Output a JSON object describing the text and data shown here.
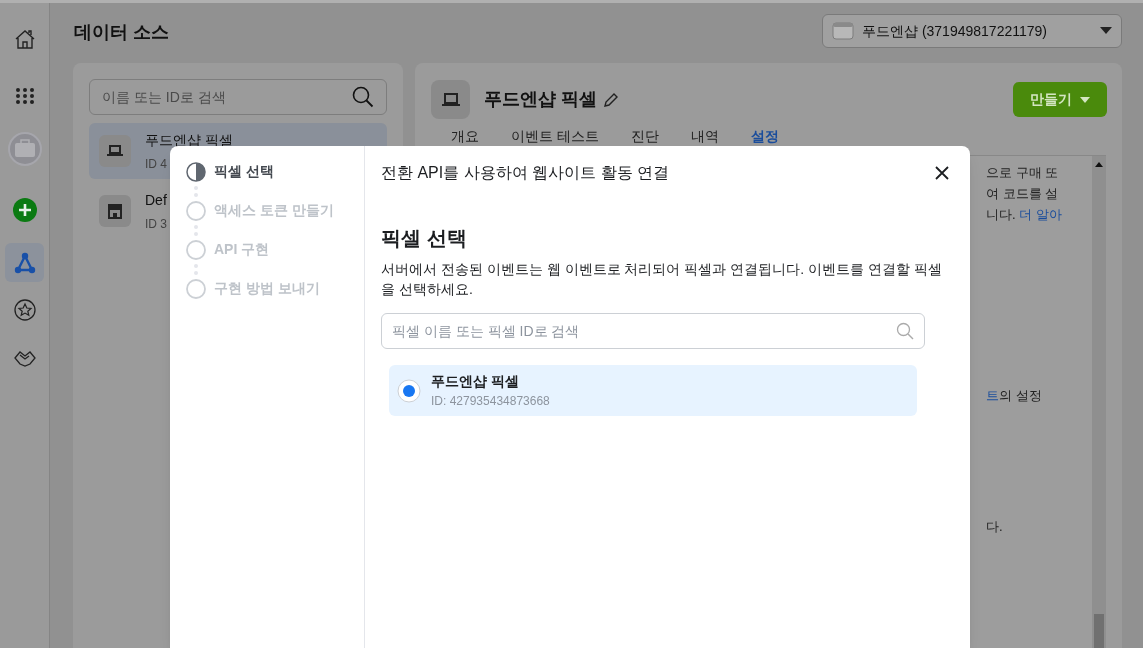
{
  "nav_rail": {
    "items": [
      {
        "kind": "home",
        "selected": false
      },
      {
        "kind": "apps",
        "selected": false
      },
      {
        "kind": "account",
        "selected": false
      },
      {
        "kind": "add",
        "selected": false
      },
      {
        "kind": "events",
        "selected": true
      },
      {
        "kind": "star",
        "selected": false
      },
      {
        "kind": "partner",
        "selected": false
      }
    ]
  },
  "header": {
    "title": "데이터 소스",
    "account_selector": "푸드엔샵 (371949817221179)"
  },
  "sources_panel": {
    "search": {
      "placeholder": "이름 또는 ID로 검색"
    },
    "items": [
      {
        "kind": "pixel",
        "name": "푸드엔샵 픽셀",
        "id": "ID 4",
        "selected": true
      },
      {
        "kind": "shop",
        "name": "Def",
        "id": "ID 3",
        "selected": false
      }
    ]
  },
  "detail_panel": {
    "title": "푸드엔샵 픽셀",
    "create_button": "만들기",
    "tabs": [
      {
        "label": "개요",
        "selected": false
      },
      {
        "label": "이벤트 테스트",
        "selected": false
      },
      {
        "label": "진단",
        "selected": false
      },
      {
        "label": "내역",
        "selected": false
      },
      {
        "label": "설정",
        "selected": true
      }
    ],
    "text_fragments": [
      {
        "parts": [
          {
            "text": "으로 구매 또",
            "link": false
          }
        ]
      },
      {
        "parts": [
          {
            "text": "여 코드를 설",
            "link": false
          }
        ]
      },
      {
        "parts": [
          {
            "text": "니다. ",
            "link": false
          },
          {
            "text": "더 알아",
            "link": true
          }
        ]
      },
      {
        "parts": [
          {
            "text": "트",
            "link": true
          },
          {
            "text": "의 설정",
            "link": false
          }
        ]
      },
      {
        "parts": [
          {
            "text": "다.",
            "link": false
          }
        ]
      }
    ]
  },
  "dialog": {
    "title": "전환 API를 사용하여 웹사이트 활동 연결",
    "steps": [
      {
        "label": "픽셀 선택",
        "selected": true
      },
      {
        "label": "액세스 토큰 만들기",
        "selected": false
      },
      {
        "label": "API 구현",
        "selected": false
      },
      {
        "label": "구현 방법 보내기",
        "selected": false
      }
    ],
    "heading": "픽셀 선택",
    "description": "서버에서 전송된 이벤트는 웹 이벤트로 처리되어 픽셀과 연결됩니다. 이벤트를 연결할 픽셀을 선택하세요.",
    "search": {
      "placeholder": "픽셀 이름 또는 픽셀 ID로 검색"
    },
    "pixels": [
      {
        "name": "푸드엔샵 픽셀",
        "id": "ID: 427935434873668",
        "selected": true
      }
    ]
  }
}
